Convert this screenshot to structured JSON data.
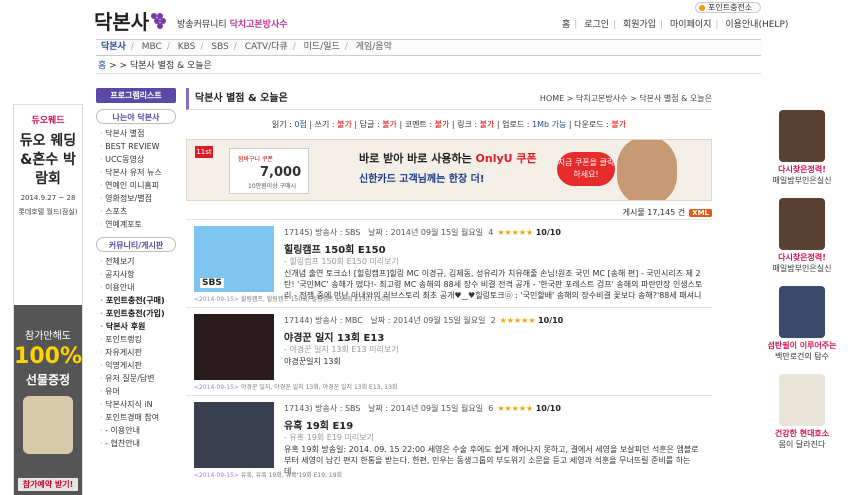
{
  "header": {
    "logo_text": "닥본사",
    "slogan_prefix": "방송커뮤니티",
    "slogan_highlight": "닥치고본방사수",
    "point_charge": "포인트충전소",
    "top_menu": [
      "홈",
      "로그인",
      "회원가입",
      "마이페이지",
      "이용안내(HELP)"
    ]
  },
  "gnb": {
    "items": [
      "닥본사",
      "MBC",
      "KBS",
      "SBS",
      "CATV/다큐",
      "미드/일드",
      "게임/음악"
    ]
  },
  "breadcrumb_top": {
    "home": "홈",
    "path": "> > 닥본사 별점 & 오늘은"
  },
  "left_ad": {
    "brand": "듀오웨드",
    "headline": "듀오 웨딩&혼수 박람회",
    "dates": "2014.9.27 ~ 28",
    "venue": "롯데호텔 월드(잠실)",
    "promo_line1": "참가만해도",
    "promo_pct": "100%",
    "promo_line2": "선물증정",
    "promo_button": "참가예약 받기!"
  },
  "left_nav": {
    "program_list": "프로그램리스트",
    "section1_title": "나는야 닥본사",
    "section1_items": [
      "닥본사 별점",
      "BEST REVIEW",
      "UCC동영상",
      "닥본사 유저 뉴스",
      "연예인 미니홈피",
      "영화정보/별점",
      "스포츠",
      "연예계포토"
    ],
    "section2_title": "커뮤니티/게시판",
    "section2_items": [
      "전체보기",
      "공지사항",
      "이용안내",
      "포인트충전(구매)",
      "포인트충전(가입)",
      "닥본사 후원",
      "포인트랭킹",
      "자유게시판",
      "익명게시판",
      "유저 질문/답변",
      "유머",
      "닥본사지식 iN",
      "포인트경매 참여",
      "- 이용안내",
      "- 협찬안내"
    ],
    "section2_bold": [
      3,
      4,
      5
    ]
  },
  "main": {
    "board_title": "닥본사 별점 & 오늘은",
    "location": "HOME > 닥치고본방사수 > 닥본사 별점 & 오늘은",
    "permissions": [
      {
        "label": "읽기",
        "value": "0점",
        "color": "blue"
      },
      {
        "label": "쓰기",
        "value": "불가",
        "color": "red"
      },
      {
        "label": "답글",
        "value": "불가",
        "color": "red"
      },
      {
        "label": "코멘트",
        "value": "불가",
        "color": "red"
      },
      {
        "label": "링크",
        "value": "불가",
        "color": "red"
      },
      {
        "label": "업로드",
        "value": "1Mb 가능",
        "color": "blue"
      },
      {
        "label": "다운로드",
        "value": "불가",
        "color": "red"
      }
    ],
    "banner": {
      "mark": "11st",
      "card_label": "잠바구니 쿠폰",
      "card_price": "7,000",
      "card_sub": "10만원이상 구매시",
      "line1_a": "바로 받아 바로 사용하는 ",
      "line1_b": "OnlyU 쿠폰",
      "line2": "신한카드 고객님께는 한장 더!",
      "cta": "지금 쿠폰을 클릭하세요!"
    },
    "count_text": "게시물 17,145 건",
    "xml_label": "XML",
    "posts": [
      {
        "num": "17145) 방송사 : SBS",
        "date": "날짜 : 2014년 09월 15일 월요일",
        "rating": "4",
        "stars": "★★★★★",
        "score": "10/10",
        "title": "힐링캠프 150회 E150",
        "subtitle": "- 힐링캠프 150회 E150 미리보기",
        "desc": "신개념 출연 토크쇼! [힐링캠프]힐링 MC 이경규, 김제동, 성유리가 치유해줄 손님!원조 국민 MC [송해 편] - 국민시리즈 제 2탄! '국민MC' 송해가 떴다!- 최고령 MC 송해의 88세 장수 비결 전격 공개 - '한국판 포레스트 검프' 송해의 파란만장 인생스토리 - 전쟁 중에 만난 아내와의 러브스토리 최초 공개♥‿♥힐링토크㉧ : '국민할배' 송해의 장수비결 꽃보다 송해?'88세 패셔니스타'로 등극! 건강 유지 비법! BMW(배? 무엇일까 4시에 목욕탕?)송해표 화...",
        "tags": "힐링캠프, 힐링캠프 150회, 힐링캠프 150회 E150, 150회",
        "thumb_label": "SBS",
        "date_tag": "<2014-09-15>"
      },
      {
        "num": "17144) 방송사 : MBC",
        "date": "날짜 : 2014년 09월 15일 월요일",
        "rating": "2",
        "stars": "★★★★★",
        "score": "10/10",
        "title": "야경꾼 일지 13회 E13",
        "subtitle": "- 야경꾼 일지 13회 E13 미리보기",
        "desc": "야경꾼일지 13회",
        "tags": "야경꾼 일지, 야경꾼 일지 13회, 야경꾼 일지 13회 E13, 13회",
        "thumb_label": "",
        "date_tag": "<2014-09-15>"
      },
      {
        "num": "17143) 방송사 : SBS",
        "date": "날짜 : 2014년 09월 15일 월요일",
        "rating": "6",
        "stars": "★★★★★",
        "score": "10/10",
        "title": "유혹 19회 E19",
        "subtitle": "- 유혹 19회 E19 미리보기",
        "desc": "유혹 19회 방송일: 2014. 09. 15 22:00 세영은 수술 후에도 쉽게 깨어나지 못하고, 결에서 세영을 보살피던 석훈은 엠블로부터 세영이 남긴 편지 한통을 받는다. 한편, 민우는 동생그룹의 부도위기 소문을 듣고 세영과 석훈을 무너뜨릴 준비를 하는데...",
        "tags": "유혹, 유혹 19회, 유혹 19회 E19, 19회",
        "thumb_label": "",
        "date_tag": "<2014-09-15>"
      }
    ]
  },
  "right_ad": [
    {
      "headline": "다시찾은정력!",
      "sub": "매일밤부인은실신"
    },
    {
      "headline": "다시찾은정력!",
      "sub": "매일밤부인은실신"
    },
    {
      "headline": "섬탄필이 이루어주는",
      "sub": "백만로건의 탐수"
    },
    {
      "headline": "건강한 현대호소",
      "sub": "몸이 달라진다"
    }
  ]
}
